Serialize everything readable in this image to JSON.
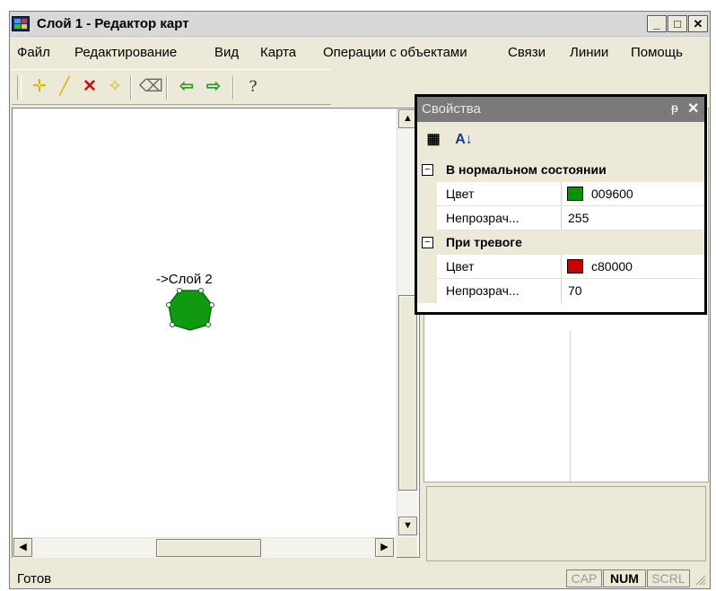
{
  "window": {
    "title": "Слой 1 - Редактор карт",
    "minimize": "_",
    "maximize": "□",
    "close": "✕"
  },
  "menu": [
    "Файл",
    "Редактирование",
    "Вид",
    "Карта",
    "Операции с объектами",
    "Связи",
    "Линии",
    "Помощь"
  ],
  "toolbar": {
    "buttons": [
      {
        "icon": "add-point-icon",
        "glyph": "✛"
      },
      {
        "icon": "draw-line-icon",
        "glyph": "╱"
      },
      {
        "icon": "delete-icon",
        "glyph": "✕"
      },
      {
        "icon": "edit-vertices-icon",
        "glyph": "✧"
      },
      {
        "icon": "eraser-icon",
        "glyph": "⌫"
      },
      {
        "icon": "undo-icon",
        "glyph": "⇦"
      },
      {
        "icon": "redo-icon",
        "glyph": "⇨"
      },
      {
        "icon": "help-icon",
        "glyph": "?"
      }
    ]
  },
  "canvas": {
    "object_label": "->Слой 2",
    "object_color": "#009600"
  },
  "scroll": {
    "up": "▲",
    "down": "▼",
    "left": "◀",
    "right": "▶"
  },
  "properties": {
    "title": "Свойства",
    "pin": "ᵽ",
    "close": "✕",
    "tools": {
      "categorized": "▦",
      "sort": "A↓"
    },
    "categories": [
      {
        "name": "В нормальном состоянии",
        "toggle": "−",
        "props": [
          {
            "name": "Цвет",
            "value": "009600",
            "swatch": "#009600"
          },
          {
            "name": "Непрозрач...",
            "value": "255"
          }
        ]
      },
      {
        "name": "При тревоге",
        "toggle": "−",
        "props": [
          {
            "name": "Цвет",
            "value": "c80000",
            "swatch": "#c80000"
          },
          {
            "name": "Непрозрач...",
            "value": "70"
          }
        ]
      }
    ]
  },
  "status": {
    "text": "Готов",
    "cap": "CAP",
    "num": "NUM",
    "scrl": "SCRL"
  }
}
